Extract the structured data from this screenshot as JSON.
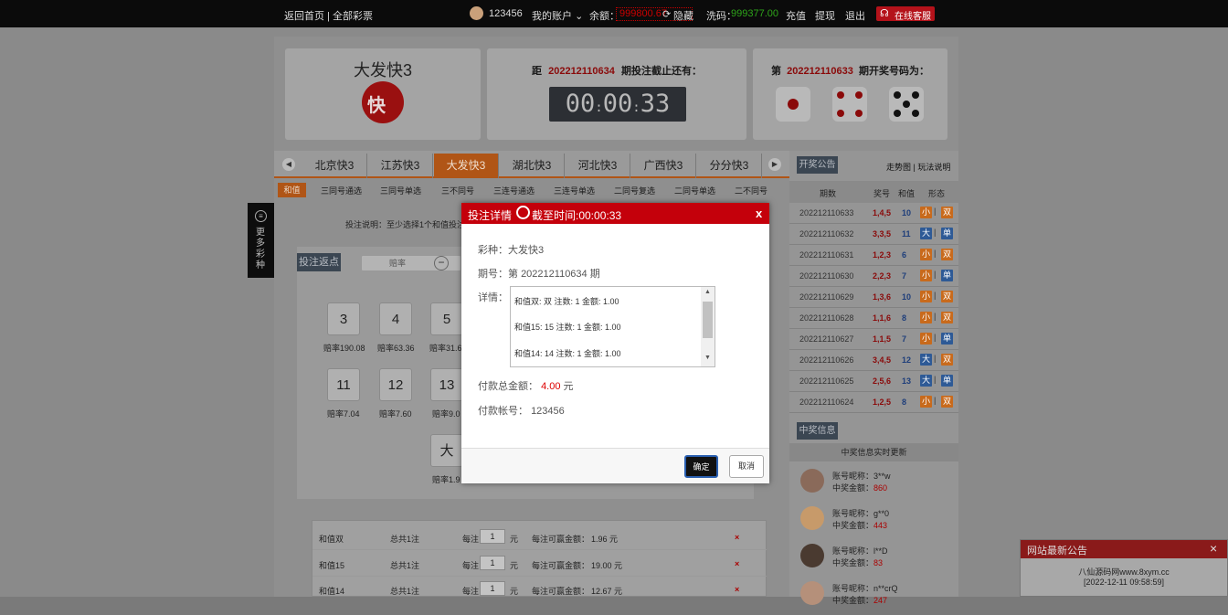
{
  "topbar": {
    "home": "返回首页 | 全部彩票",
    "username": "123456",
    "my_account": "我的账户",
    "balance_label": "余额：",
    "balance_value": "999800.67",
    "hide_label": "隐藏",
    "flow_label": "洗码：",
    "flow_value": "999377.00",
    "recharge": "充值",
    "withdraw": "提现",
    "logout": "退出",
    "service": "在线客服"
  },
  "lottery": {
    "name": "大发快3",
    "countdown_prefix": "距",
    "countdown_period": "202212110634",
    "countdown_suffix": "期投注截止还有：",
    "timer_hh": "00",
    "timer_mm": "00",
    "timer_ss": "33",
    "result_prefix": "第",
    "result_period": "202212110633",
    "result_suffix": "期开奖号码为：",
    "dice": [
      1,
      4,
      5
    ]
  },
  "side_tab": "更多彩种",
  "tabs": [
    "北京快3",
    "江苏快3",
    "大发快3",
    "湖北快3",
    "河北快3",
    "广西快3",
    "分分快3"
  ],
  "active_tab": 2,
  "subtabs": [
    "和值",
    "三同号通选",
    "三同号单选",
    "三不同号",
    "三连号通选",
    "三连号单选",
    "二同号复选",
    "二同号单选",
    "二不同号"
  ],
  "bet_hint": "投注说明：至少选择1个和值投注",
  "rebate_label": "投注返点",
  "odds_placeholder": "赔率",
  "numbers": [
    {
      "n": "3",
      "odds": "赔率190.08"
    },
    {
      "n": "4",
      "odds": "赔率63.36"
    },
    {
      "n": "5",
      "odds": "赔率31.6"
    },
    {
      "n": "11",
      "odds": "赔率7.04"
    },
    {
      "n": "12",
      "odds": "赔率7.60"
    },
    {
      "n": "13",
      "odds": "赔率9.0"
    },
    {
      "n": "大",
      "odds": "赔率1.9"
    }
  ],
  "bets": [
    {
      "name": "和值双",
      "total": "总共1注",
      "per_label": "每注",
      "per": "1",
      "unit": "元",
      "win_label": "每注可赢金额：",
      "win": "1.96 元"
    },
    {
      "name": "和值15",
      "total": "总共1注",
      "per_label": "每注",
      "per": "1",
      "unit": "元",
      "win_label": "每注可赢金额：",
      "win": "19.00 元"
    },
    {
      "name": "和值14",
      "total": "总共1注",
      "per_label": "每注",
      "per": "1",
      "unit": "元",
      "win_label": "每注可赢金额：",
      "win": "12.67 元"
    }
  ],
  "history": {
    "announce_btn": "开奖公告",
    "links": "走势图 | 玩法说明",
    "headers": [
      "期数",
      "奖号",
      "和值",
      "形态"
    ],
    "rows": [
      {
        "period": "202212110633",
        "nums": "1,4,5",
        "sum": "10",
        "size": "小",
        "parity": "双"
      },
      {
        "period": "202212110632",
        "nums": "3,3,5",
        "sum": "11",
        "size": "大",
        "parity": "单"
      },
      {
        "period": "202212110631",
        "nums": "1,2,3",
        "sum": "6",
        "size": "小",
        "parity": "双"
      },
      {
        "period": "202212110630",
        "nums": "2,2,3",
        "sum": "7",
        "size": "小",
        "parity": "单"
      },
      {
        "period": "202212110629",
        "nums": "1,3,6",
        "sum": "10",
        "size": "小",
        "parity": "双"
      },
      {
        "period": "202212110628",
        "nums": "1,1,6",
        "sum": "8",
        "size": "小",
        "parity": "双"
      },
      {
        "period": "202212110627",
        "nums": "1,1,5",
        "sum": "7",
        "size": "小",
        "parity": "单"
      },
      {
        "period": "202212110626",
        "nums": "3,4,5",
        "sum": "12",
        "size": "大",
        "parity": "双"
      },
      {
        "period": "202212110625",
        "nums": "2,5,6",
        "sum": "13",
        "size": "大",
        "parity": "单"
      },
      {
        "period": "202212110624",
        "nums": "1,2,5",
        "sum": "8",
        "size": "小",
        "parity": "双"
      }
    ]
  },
  "winners": {
    "title": "中奖信息",
    "subtitle": "中奖信息实时更新",
    "nick_label": "账号昵称：",
    "amount_label": "中奖金额：",
    "list": [
      {
        "nick": "3**w",
        "amount": "860"
      },
      {
        "nick": "g**0",
        "amount": "443"
      },
      {
        "nick": "l**D",
        "amount": "83"
      },
      {
        "nick": "n**crQ",
        "amount": "247"
      }
    ]
  },
  "modal": {
    "title": "投注详情",
    "deadline": "截至时间:00:00:33",
    "close": "x",
    "lottery_label": "彩种：",
    "lottery_value": "大发快3",
    "period_label": "期号：第",
    "period_value": "202212110634",
    "period_suffix": "期",
    "detail_label": "详情：",
    "details": [
      "和值双: 双   注数: 1   金额: 1.00",
      "和值15: 15   注数: 1   金额: 1.00",
      "和值14: 14   注数: 1   金额: 1.00"
    ],
    "total_label": "付款总金额：",
    "total_value": "4.00",
    "total_unit": "元",
    "account_label": "付款帐号：",
    "account_value": "123456",
    "confirm": "确定",
    "cancel": "取消"
  },
  "notice": {
    "title": "网站最新公告",
    "close": "×",
    "line1": "八仙源码网www.8xym.cc",
    "line2": "[2022-12-11 09:58:59]"
  },
  "colors": {
    "accent": "#c4000b",
    "tab_active": "#b05516",
    "small": "#c86a1c",
    "big": "#2e5a96"
  }
}
